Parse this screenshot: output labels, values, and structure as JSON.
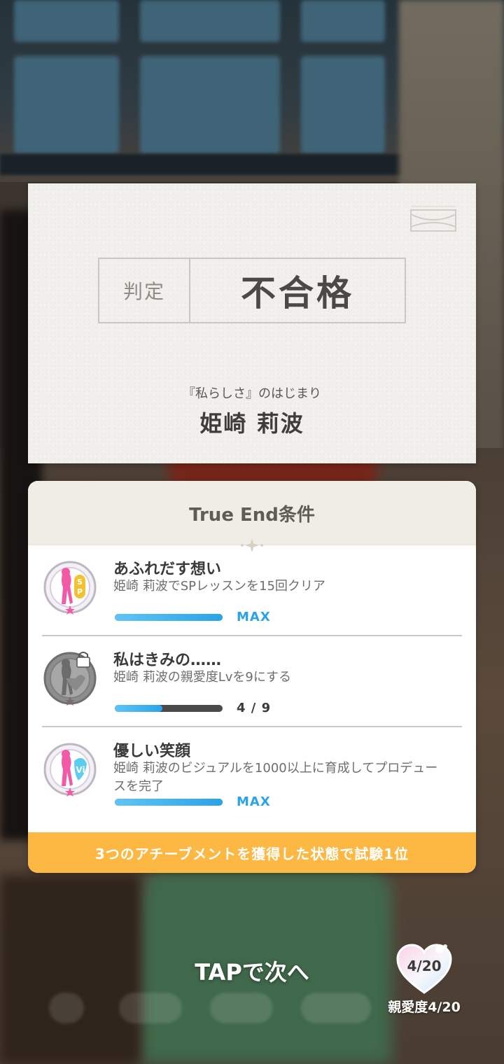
{
  "result": {
    "verdict_label": "判定",
    "verdict_value": "不合格",
    "scenario_subtitle": "『私らしさ』のはじまり",
    "character_name": "姫崎 莉波"
  },
  "true_end": {
    "header": "True End条件",
    "conditions": [
      {
        "title": "あふれだす想い",
        "description": "姫崎 莉波でSPレッスンを15回クリア",
        "progress_text": "MAX",
        "progress": 1.0,
        "locked": false,
        "badge_icon": "sp-lesson-badge-icon"
      },
      {
        "title": "私はきみの……",
        "description": "姫崎 莉波の親愛度Lvを9にする",
        "progress_text": "4 / 9",
        "progress": 0.444,
        "locked": true,
        "badge_icon": "affection-badge-locked-icon"
      },
      {
        "title": "優しい笑顔",
        "description": "姫崎 莉波のビジュアルを1000以上に育成してプロデュースを完了",
        "progress_text": "MAX",
        "progress": 1.0,
        "locked": false,
        "badge_icon": "visual-badge-icon"
      }
    ],
    "requirement": "3つのアチーブメントを獲得した状態で試験1位"
  },
  "footer": {
    "tap_next": "TAPで次へ",
    "affinity_value": "4/20",
    "affinity_label": "親愛度4/20"
  },
  "colors": {
    "progress_blue": "#2aa3e8",
    "requirement_orange": "#fdb843",
    "card_paper": "#f2f0ec"
  }
}
